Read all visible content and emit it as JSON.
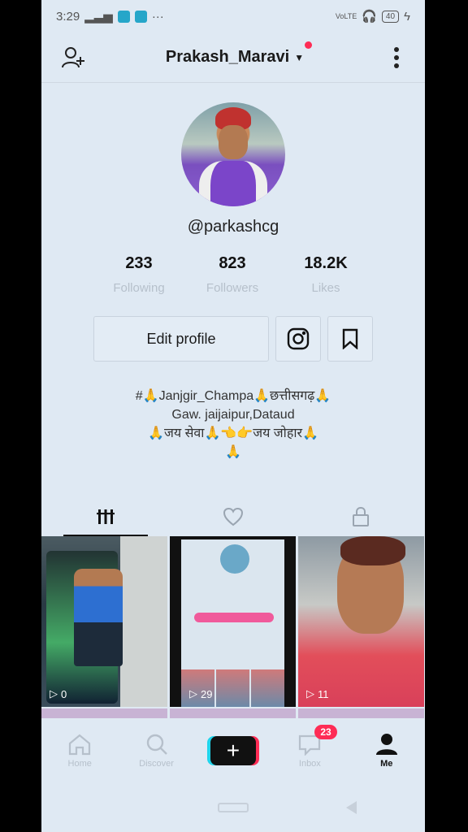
{
  "status_bar": {
    "time": "3:29",
    "extra": "···",
    "network": "VoLTE",
    "battery": "40"
  },
  "header": {
    "username": "Prakash_Maravi"
  },
  "profile": {
    "handle": "@parkashcg",
    "stats": [
      {
        "value": "233",
        "label": "Following"
      },
      {
        "value": "823",
        "label": "Followers"
      },
      {
        "value": "18.2K",
        "label": "Likes"
      }
    ],
    "edit_label": "Edit profile",
    "bio": [
      "#🙏Janjgir_Champa🙏छत्तीसगढ़🙏",
      "Gaw. jaijaipur,Dataud",
      "🙏जय सेवा🙏👈👉जय जोहार🙏",
      "🙏"
    ]
  },
  "videos": [
    {
      "views": "0"
    },
    {
      "views": "29"
    },
    {
      "views": "11"
    }
  ],
  "bottom_nav": {
    "items": [
      {
        "label": "Home"
      },
      {
        "label": "Discover"
      },
      {
        "label": "+"
      },
      {
        "label": "Inbox",
        "badge": "23"
      },
      {
        "label": "Me"
      }
    ]
  },
  "colors": {
    "accent": "#fe2c55",
    "cyan": "#20d5ec",
    "background": "#dfe9f3"
  }
}
